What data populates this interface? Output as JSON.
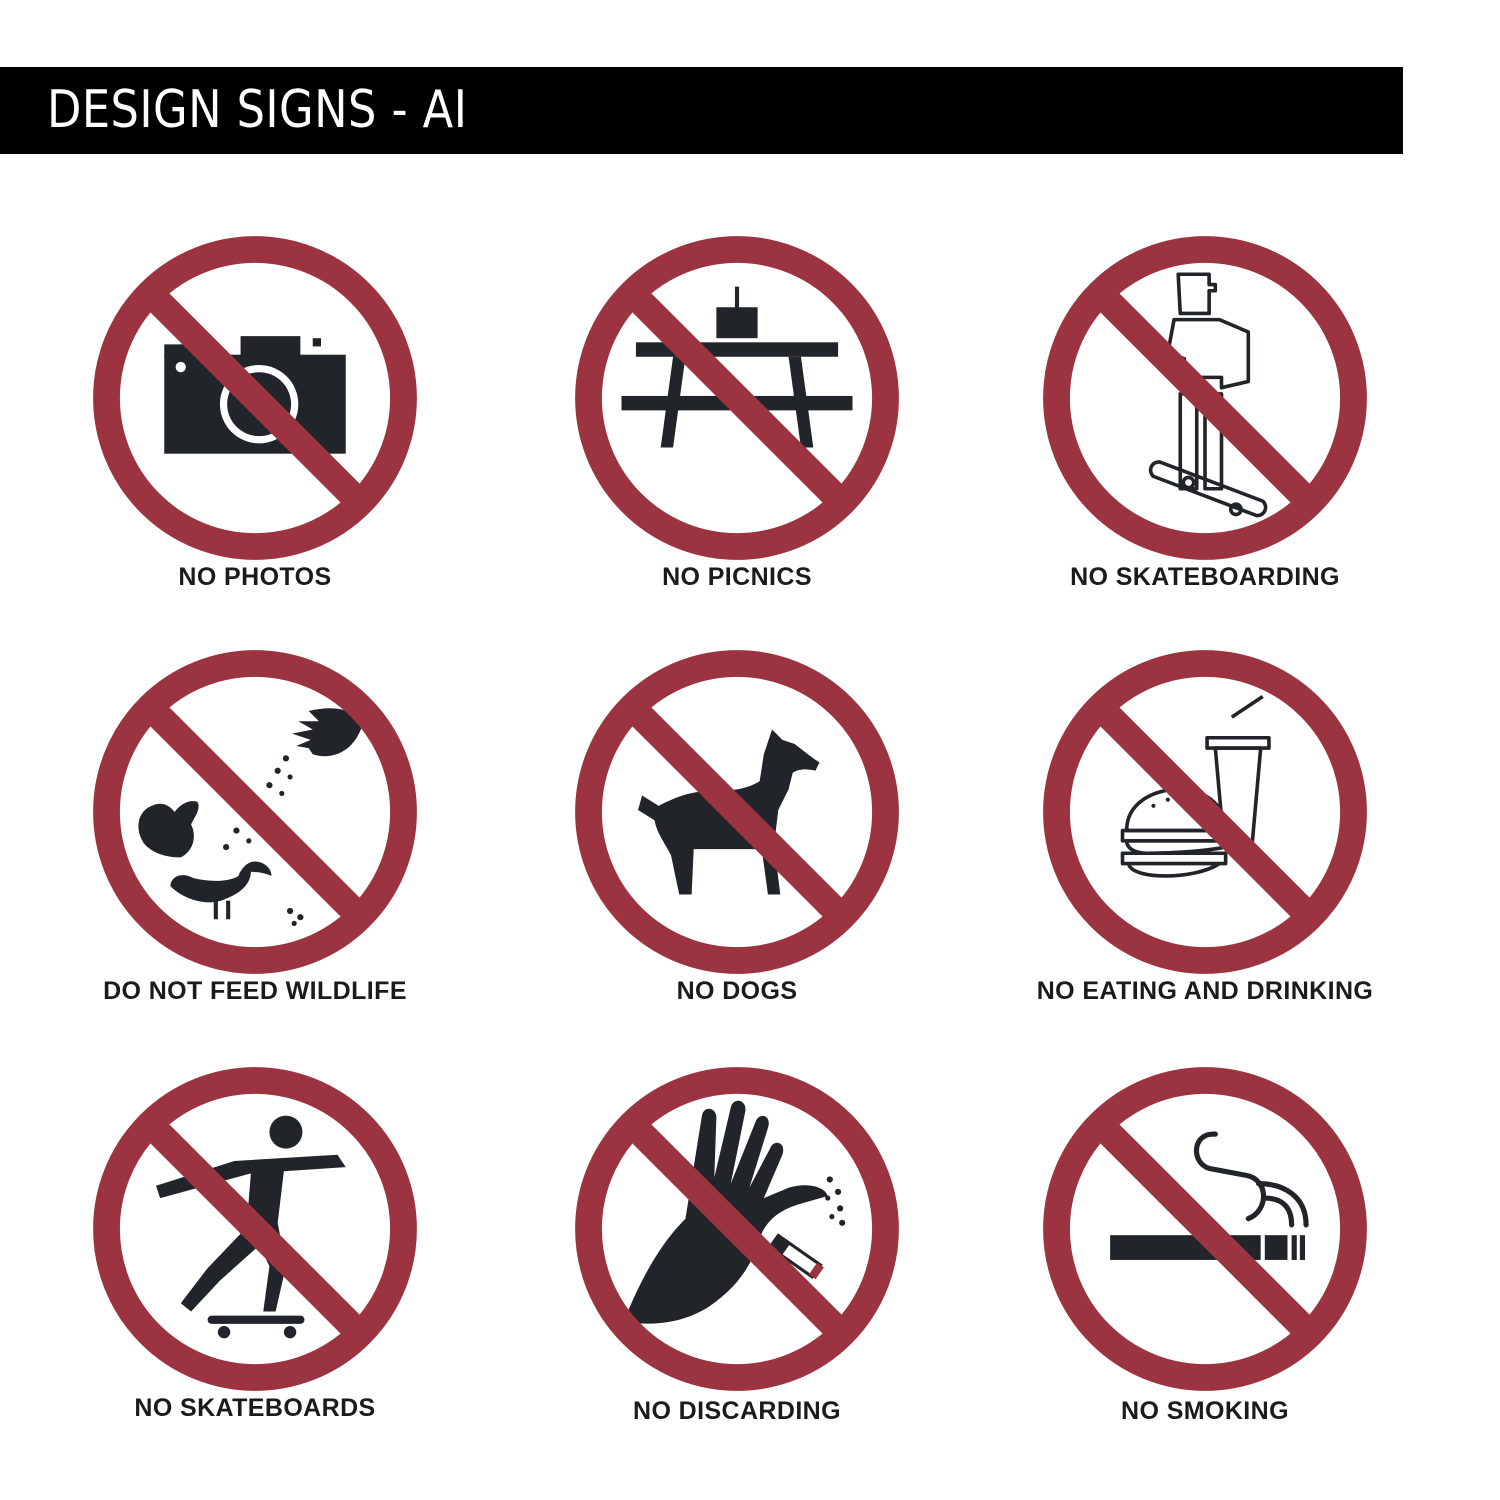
{
  "title": "DESIGN SIGNS - AI",
  "colors": {
    "prohibition_red": "#9b3440",
    "pictogram": "#212428",
    "title_bar": "#000000",
    "title_text": "#ffffff"
  },
  "signs": [
    {
      "label": "NO PHOTOS",
      "icon": "camera-icon"
    },
    {
      "label": "NO PICNICS",
      "icon": "picnic-table-icon"
    },
    {
      "label": "NO SKATEBOARDING",
      "icon": "skateboarder-outline-icon"
    },
    {
      "label": "DO NOT FEED WILDLIFE",
      "icon": "feeding-wildlife-icon"
    },
    {
      "label": "NO DOGS",
      "icon": "dog-icon"
    },
    {
      "label": "NO EATING AND DRINKING",
      "icon": "burger-and-drink-icon"
    },
    {
      "label": "NO SKATEBOARDS",
      "icon": "skateboarder-icon"
    },
    {
      "label": "NO DISCARDING",
      "icon": "hand-dropping-cigarette-icon"
    },
    {
      "label": "NO SMOKING",
      "icon": "cigarette-icon"
    }
  ]
}
